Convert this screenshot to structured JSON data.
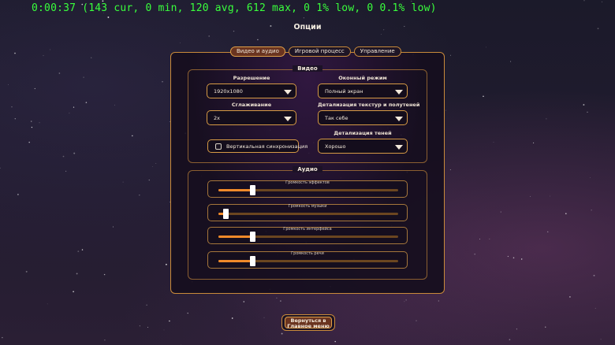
{
  "overlay": {
    "fps_counter": "0:00:37 (143 cur, 0 min, 120 avg, 612 max, 0 1% low, 0 0.1% low)"
  },
  "page_title": "Опции",
  "tabs": [
    {
      "label": "Видео и аудио",
      "active": true
    },
    {
      "label": "Игровой процесс",
      "active": false
    },
    {
      "label": "Управление",
      "active": false
    }
  ],
  "video": {
    "title": "Видео",
    "resolution": {
      "label": "Разрешение",
      "value": "1920x1080"
    },
    "window_mode": {
      "label": "Оконный режим",
      "value": "Полный экран"
    },
    "antialiasing": {
      "label": "Сглаживание",
      "value": "2x"
    },
    "texture_detail": {
      "label": "Детализация текстур и полутеней",
      "value": "Так себе"
    },
    "shadow_detail": {
      "label": "Детализация теней",
      "value": "Хорошо"
    },
    "vsync": {
      "label": "Вертикальная синхронизация",
      "checked": false
    }
  },
  "audio": {
    "title": "Аудио",
    "sliders": [
      {
        "label": "Громкость эффектов",
        "level": 0.19
      },
      {
        "label": "Громкость музыки",
        "level": 0.04
      },
      {
        "label": "Громкость интерфейса",
        "level": 0.19
      },
      {
        "label": "Громкость речи",
        "level": 0.19
      }
    ]
  },
  "back_button": {
    "line1": "Вернуться в",
    "line2": "Главное меню"
  },
  "colors": {
    "accent_border": "#c98a3a",
    "slider_fill": "#f08a2a",
    "fps_text": "#39ff3c"
  }
}
